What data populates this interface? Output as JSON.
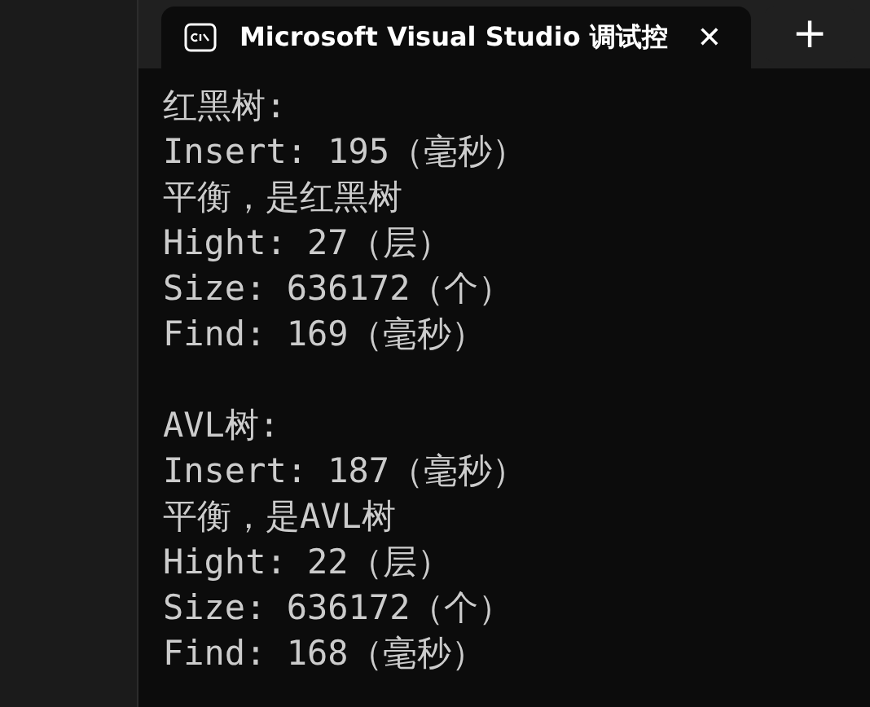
{
  "tab": {
    "title": "Microsoft Visual Studio 调试控",
    "selected": true,
    "close": "✕"
  },
  "new_tab": "+",
  "console": {
    "sections": [
      {
        "lines": [
          "红黑树:",
          "Insert: 195（毫秒）",
          "平衡，是红黑树",
          "Hight: 27（层）",
          "Size: 636172（个）",
          "Find: 169（毫秒）"
        ]
      },
      {
        "lines": [
          "AVL树:",
          "Insert: 187（毫秒）",
          "平衡，是AVL树",
          "Hight: 22（层）",
          "Size: 636172（个）",
          "Find: 168（毫秒）"
        ]
      }
    ]
  }
}
